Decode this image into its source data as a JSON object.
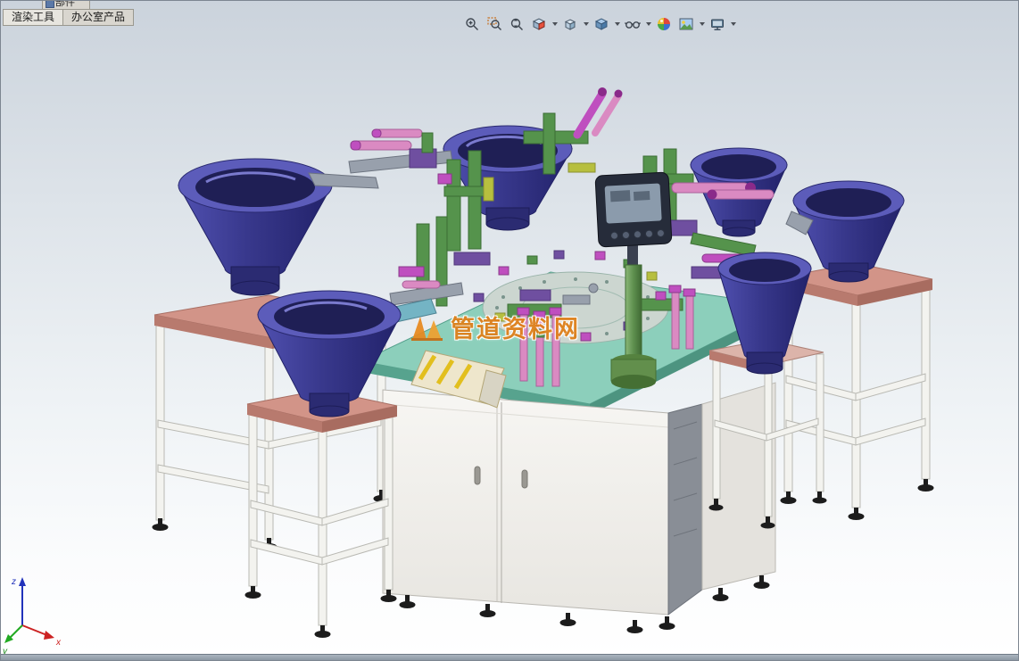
{
  "tabs": {
    "partial_top": "部件",
    "items": [
      {
        "label": "渲染工具",
        "active": true
      },
      {
        "label": "办公室产品",
        "active": false
      }
    ]
  },
  "toolbar": {
    "items": [
      {
        "name": "zoom-to-fit",
        "dropdown": false
      },
      {
        "name": "zoom-to-area",
        "dropdown": false
      },
      {
        "name": "zoom-in-out",
        "dropdown": false
      },
      {
        "name": "section-view",
        "dropdown": true
      },
      {
        "name": "view-orientation",
        "dropdown": true
      },
      {
        "name": "display-style",
        "dropdown": true
      },
      {
        "name": "hide-show-items",
        "dropdown": true
      },
      {
        "name": "edit-appearance",
        "dropdown": false
      },
      {
        "name": "apply-scene",
        "dropdown": true
      },
      {
        "name": "view-settings",
        "dropdown": true
      }
    ]
  },
  "viewport": {
    "watermark_text": "管道资料网",
    "triad": {
      "x": "x",
      "y": "y",
      "z": "z"
    },
    "model": {
      "description": "automatic rotary-index assembly machine",
      "bowl_feeders": 6,
      "components": [
        "vibratory-bowl-feeder",
        "rotary-index-table",
        "machine-cabinet",
        "hmi-control-panel",
        "feeder-stands",
        "tooling-stations",
        "discharge-chute"
      ]
    }
  },
  "colors": {
    "bg_top": "#cbd3dc",
    "table_top": "#8ccfbb",
    "table_edge": "#57a38e",
    "stand_top": "#d29488",
    "stand_band": "#b87a6e",
    "cabinet_front": "#f3f2ee",
    "cabinet_side": "#e4e2dd",
    "cabinet_panel": "#898e96",
    "bowl_rim": "#5c5cba",
    "bowl_inner": "#1f1f55",
    "fixture_green": "#55934c",
    "fixture_magenta": "#bf4fbf",
    "fixture_purple": "#6f4fa0",
    "rod_pink": "#da8ac2",
    "pole_green": "#5e8f4e",
    "watermark_orange": "#e07f18"
  }
}
